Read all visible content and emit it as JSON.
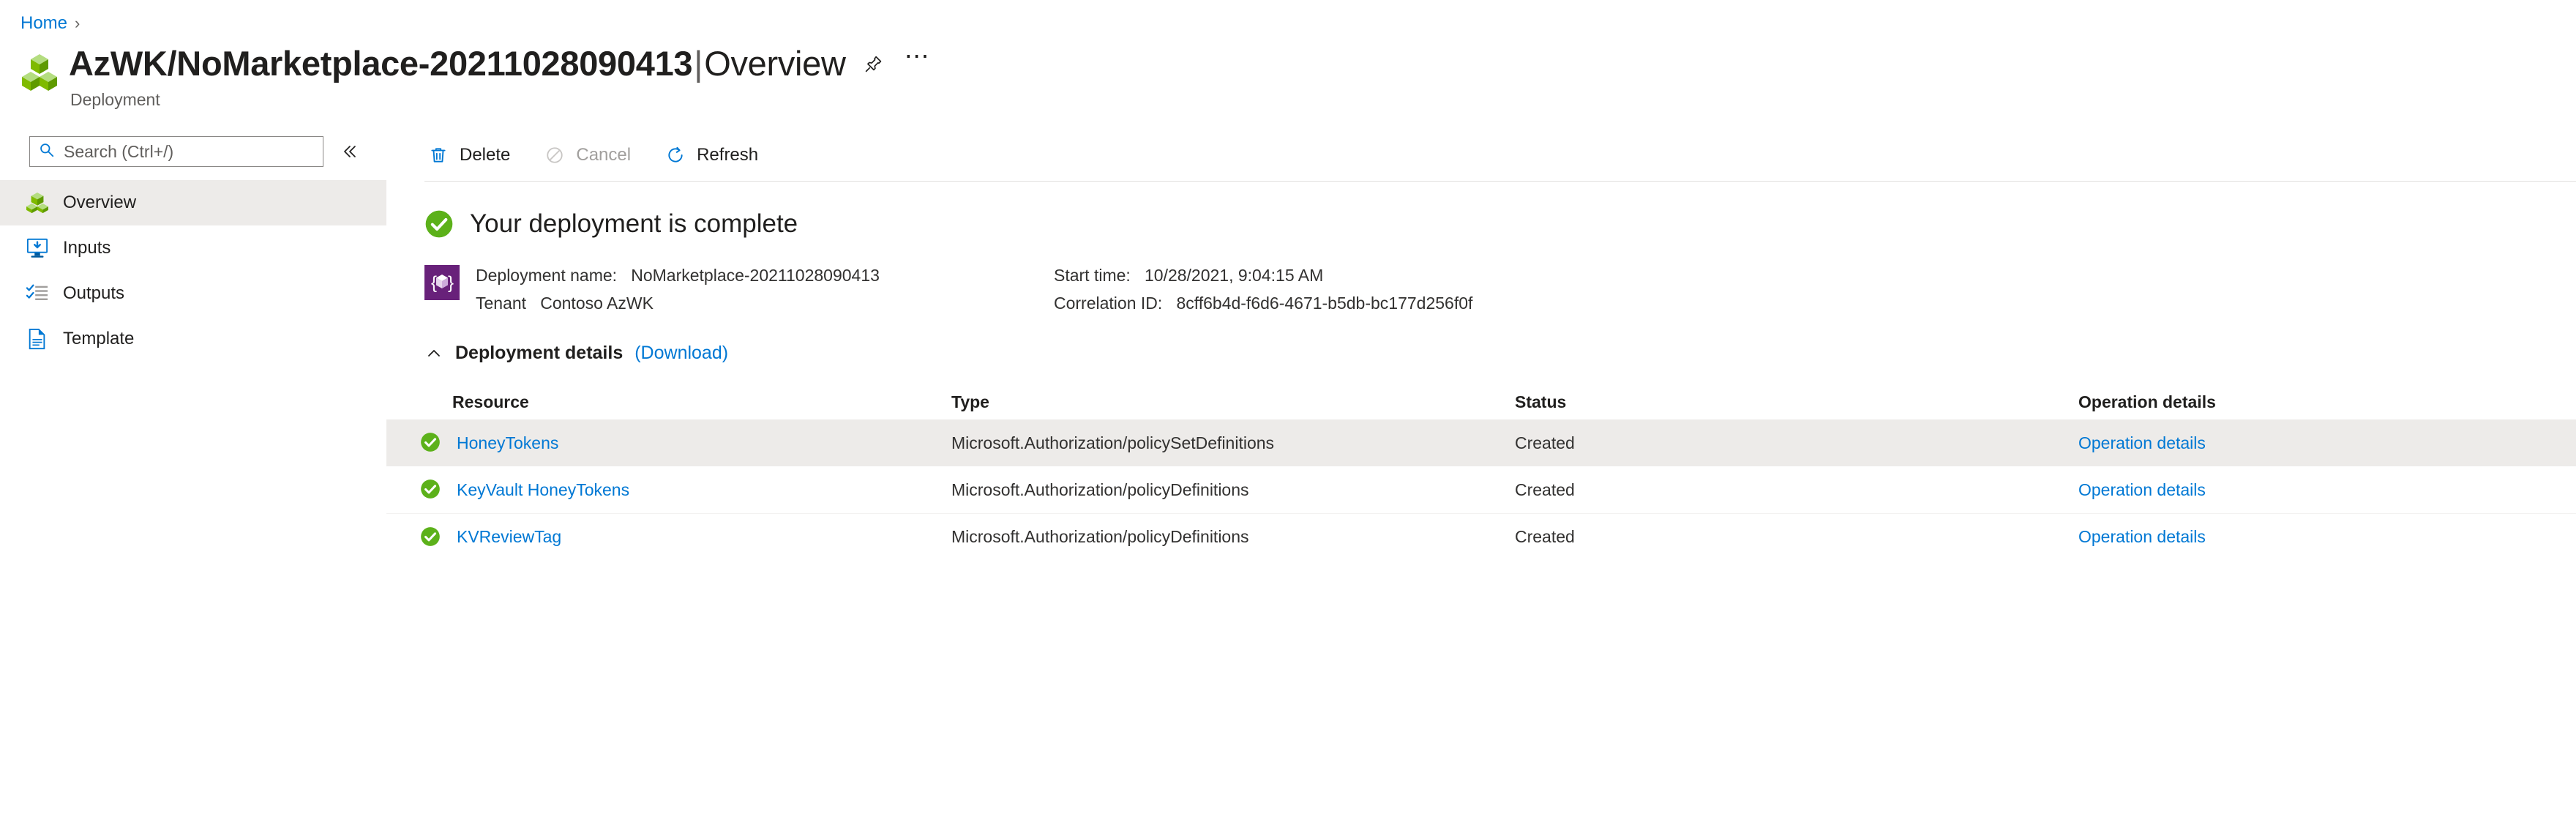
{
  "breadcrumb": {
    "items": [
      {
        "label": "Home",
        "icon": ""
      }
    ],
    "separator": "›"
  },
  "header": {
    "title": "AzWK/NoMarketplace-20211028090413",
    "separator": "|",
    "section": "Overview",
    "subtitle": "Deployment",
    "icon": "resource-group-cubes-icon",
    "pin_icon": "pin-icon",
    "more_icon": "ellipsis-icon"
  },
  "sidebar": {
    "search": {
      "placeholder": "Search (Ctrl+/)",
      "value": "",
      "icon": "search-icon"
    },
    "collapse_icon": "chevron-double-left-icon",
    "items": [
      {
        "label": "Overview",
        "icon": "cubes-icon",
        "selected": true
      },
      {
        "label": "Inputs",
        "icon": "monitor-download-icon",
        "selected": false
      },
      {
        "label": "Outputs",
        "icon": "checklist-icon",
        "selected": false
      },
      {
        "label": "Template",
        "icon": "document-icon",
        "selected": false
      }
    ]
  },
  "toolbar": {
    "delete_label": "Delete",
    "delete_icon": "trash-icon",
    "cancel_label": "Cancel",
    "cancel_icon": "ban-circle-icon",
    "cancel_disabled": true,
    "refresh_label": "Refresh",
    "refresh_icon": "refresh-icon"
  },
  "main": {
    "status_banner": {
      "icon": "success-check-icon",
      "text": "Your deployment is complete"
    },
    "summary": {
      "template_icon": "arm-template-icon",
      "deployment_name_label": "Deployment name:",
      "deployment_name_value": "NoMarketplace-20211028090413",
      "tenant_label": "Tenant",
      "tenant_value": "Contoso AzWK",
      "start_time_label": "Start time:",
      "start_time_value": "10/28/2021, 9:04:15 AM",
      "correlation_id_label": "Correlation ID:",
      "correlation_id_value": "8cff6b4d-f6d6-4671-b5db-bc177d256f0f"
    },
    "details": {
      "chevron_icon": "chevron-up-icon",
      "title": "Deployment details",
      "download_label": "(Download)",
      "columns": [
        "Resource",
        "Type",
        "Status",
        "Operation details"
      ],
      "rows": [
        {
          "status_icon": "success-check-icon",
          "resource": "HoneyTokens",
          "type": "Microsoft.Authorization/policySetDefinitions",
          "status": "Created",
          "operation": "Operation details",
          "highlighted": true
        },
        {
          "status_icon": "success-check-icon",
          "resource": "KeyVault HoneyTokens",
          "type": "Microsoft.Authorization/policyDefinitions",
          "status": "Created",
          "operation": "Operation details",
          "highlighted": false
        },
        {
          "status_icon": "success-check-icon",
          "resource": "KVReviewTag",
          "type": "Microsoft.Authorization/policyDefinitions",
          "status": "Created",
          "operation": "Operation details",
          "highlighted": false
        }
      ]
    }
  },
  "colors": {
    "link": "#0078d4",
    "success_green": "#5cb11a",
    "template_purple": "#68217a",
    "row_highlight": "#edebe9",
    "disabled_gray": "#a19f9d"
  }
}
